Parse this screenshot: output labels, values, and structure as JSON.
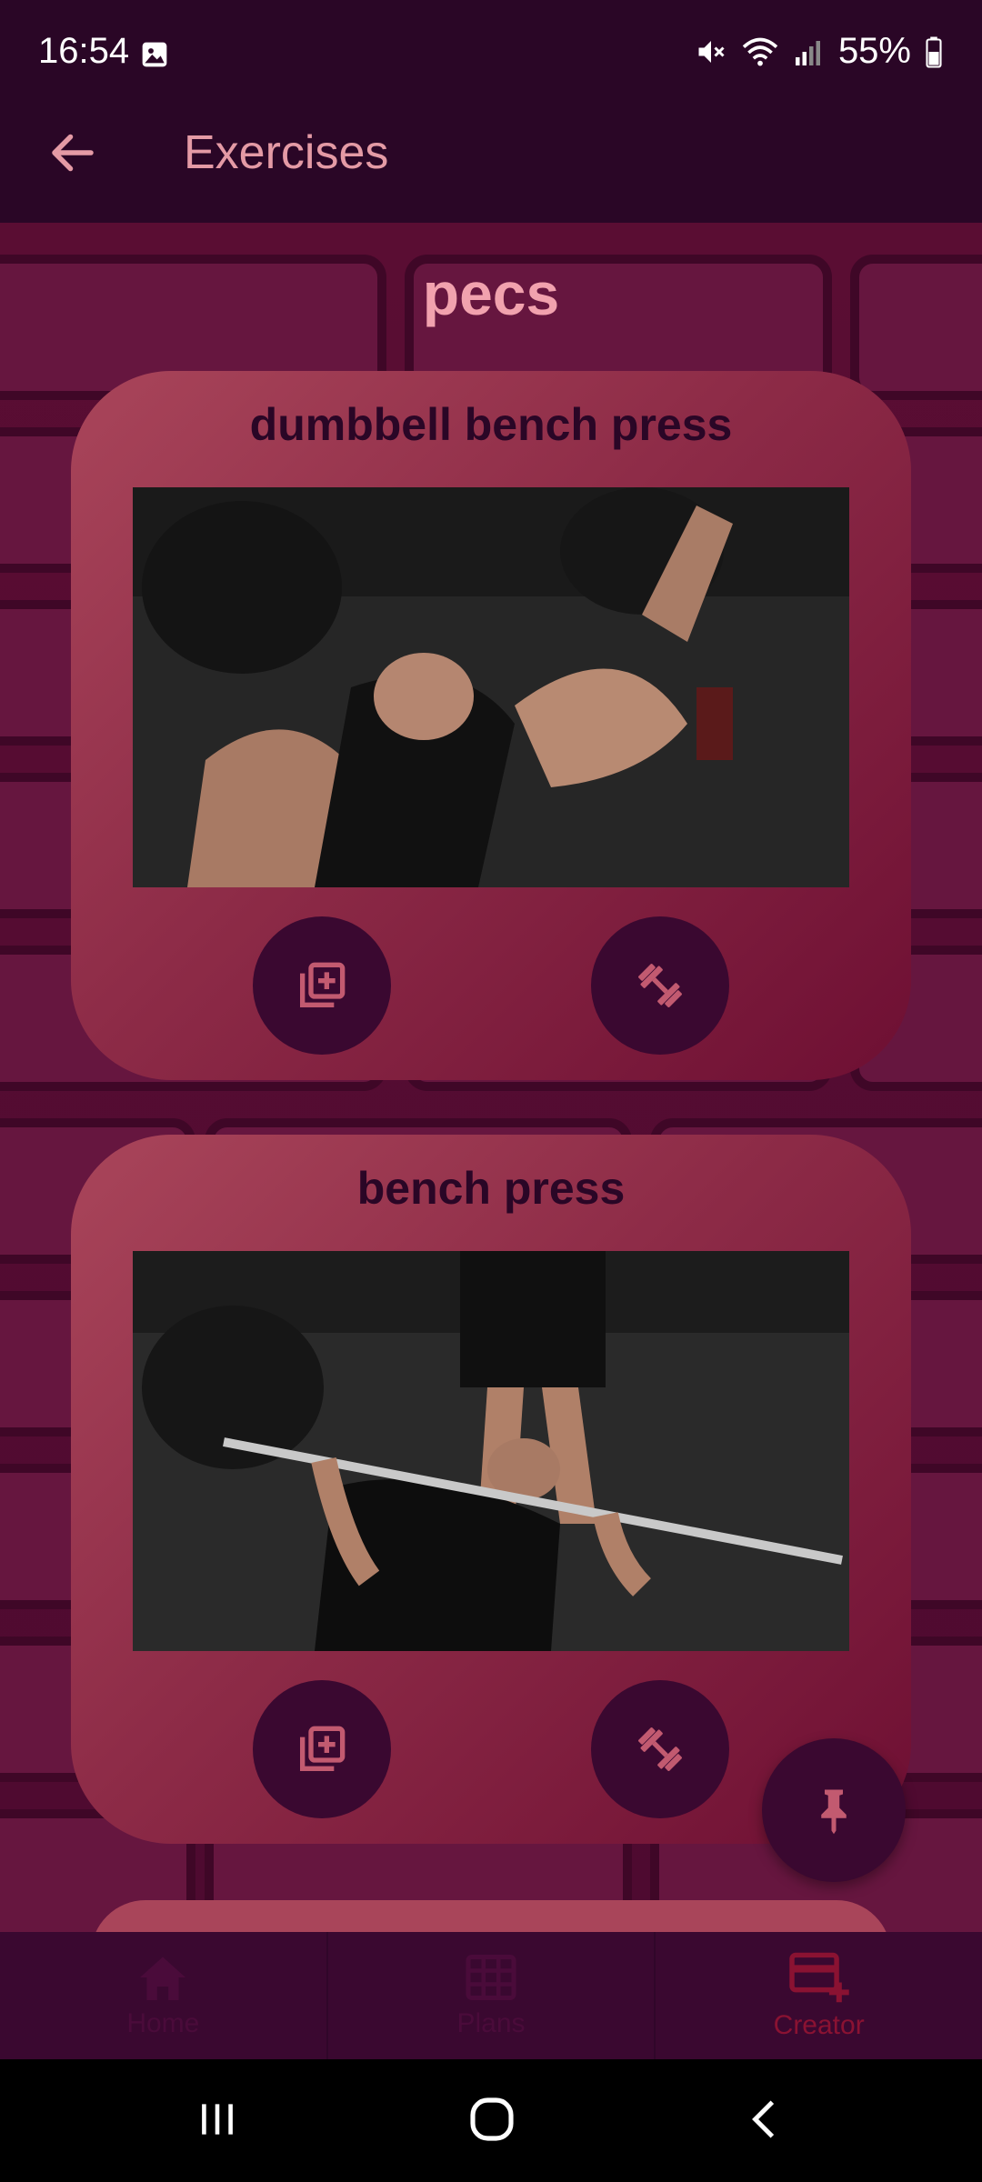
{
  "status_bar": {
    "time": "16:54",
    "battery": "55%"
  },
  "app_bar": {
    "title": "Exercises"
  },
  "section": {
    "title": "pecs"
  },
  "exercises": [
    {
      "name": "dumbbell bench press"
    },
    {
      "name": "bench press"
    }
  ],
  "bottom_nav": {
    "items": [
      {
        "label": "Home",
        "icon": "home-icon"
      },
      {
        "label": "Plans",
        "icon": "grid-icon"
      },
      {
        "label": "Creator",
        "icon": "card-add-icon"
      }
    ],
    "active": "Creator"
  },
  "colors": {
    "background": "#2a0626",
    "accent": "#e49aa5",
    "card": "#a9455a",
    "button": "#3a0830"
  }
}
